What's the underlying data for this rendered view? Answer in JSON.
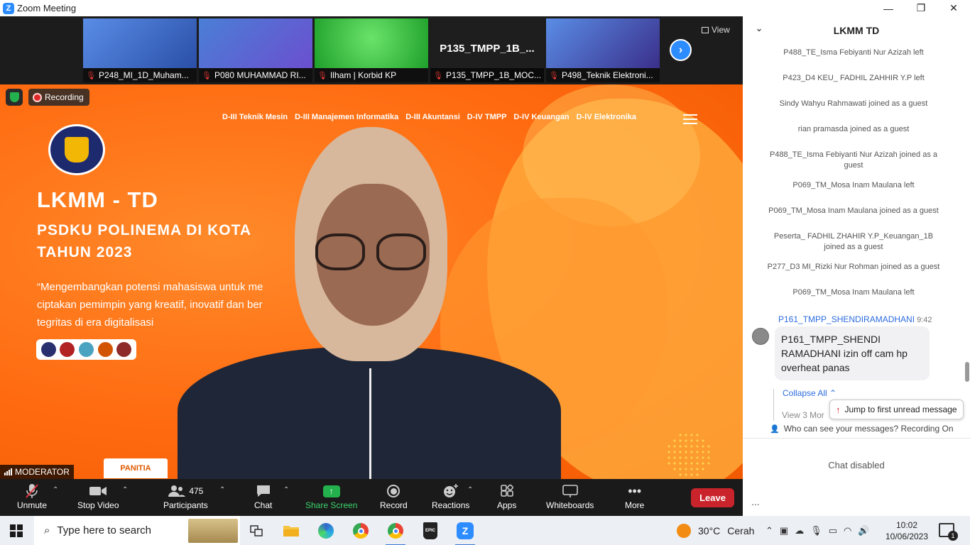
{
  "window": {
    "title": "Zoom Meeting",
    "logo_letter": "Z",
    "controls": {
      "minimize": "—",
      "restore": "❐",
      "close": "✕"
    }
  },
  "thumbnails": [
    {
      "name": "P248_MI_1D_Muham...",
      "muted": true,
      "bg": "#4a7fd6"
    },
    {
      "name": "P080 MUHAMMAD RI...",
      "muted": true,
      "bg": "#3c6fd0"
    },
    {
      "name": "Ilham | Korbid KP",
      "muted": true,
      "bg": "#2fbf3a"
    },
    {
      "name": "P135_TMPP_1B_MOC...",
      "muted": true,
      "bg": "#1e1e1e",
      "display_name": "P135_TMPP_1B_..."
    },
    {
      "name": "P498_Teknik Elektroni...",
      "muted": true,
      "bg": "#4a7fd6"
    }
  ],
  "view_button": "View",
  "next_arrow": "›",
  "main_video": {
    "recording_label": "Recording",
    "moderator_label": "MODERATOR",
    "slide": {
      "nav_links": [
        "D-III Teknik Mesin",
        "D-III Manajemen Informatika",
        "D-III Akuntansi",
        "D-IV TMPP",
        "D-IV Keuangan",
        "D-IV Elektronika"
      ],
      "title": "LKMM - TD",
      "subtitle_line1": "PSDKU POLINEMA DI KOTA",
      "subtitle_line2": "TAHUN 2023",
      "quote": "“Mengembangkan potensi mahasiswa untuk me\nciptakan pemimpin yang kreatif, inovatif dan ber\ntegritas di era digitalisasi",
      "panitia": "PANITIA"
    }
  },
  "toolbar": {
    "unmute": "Unmute",
    "stop_video": "Stop Video",
    "participants": "Participants",
    "participants_count": "475",
    "chat": "Chat",
    "share_screen": "Share Screen",
    "record": "Record",
    "reactions": "Reactions",
    "apps": "Apps",
    "whiteboards": "Whiteboards",
    "more": "More",
    "leave": "Leave",
    "colors": {
      "leave": "#c9232b",
      "share": "#23b14d"
    }
  },
  "chat": {
    "title": "LKMM TD",
    "system_messages": [
      "P488_TE_Isma Febiyanti Nur Azizah left",
      "P423_D4 KEU_ FADHIL ZAHHIR Y.P left",
      "Sindy Wahyu Rahmawati joined as a guest",
      "rian pramasda joined as a guest",
      "P488_TE_Isma Febiyanti Nur Azizah joined as a guest",
      "P069_TM_Mosa Inam Maulana left",
      "P069_TM_Mosa Inam Maulana joined as a guest",
      "Peserta_ FADHIL ZHAHIR Y.P_Keuangan_1B joined as a guest",
      "P277_D3 MI_Rizki Nur Rohman joined as a guest",
      "P069_TM_Mosa Inam Maulana left"
    ],
    "message": {
      "sender": "P161_TMPP_SHENDIRAMADHANI",
      "time": "9:42",
      "text": "P161_TMPP_SHENDI RAMADHANI izin off cam hp overheat panas"
    },
    "collapse_all": "Collapse All",
    "view_more": "View 3 Mor",
    "jump_unread": "Jump to first unread message",
    "who_can_see": "Who can see your messages? Recording On",
    "chat_disabled": "Chat disabled",
    "ellipsis": "..."
  },
  "taskbar": {
    "search_placeholder": "Type here to search",
    "weather_temp": "30°C",
    "weather_text": "Cerah",
    "time": "10:02",
    "date": "10/06/2023",
    "notification_count": "1",
    "apps": [
      "task-view",
      "file-explorer",
      "edge",
      "chrome",
      "chrome-2",
      "epic-games",
      "zoom"
    ]
  }
}
